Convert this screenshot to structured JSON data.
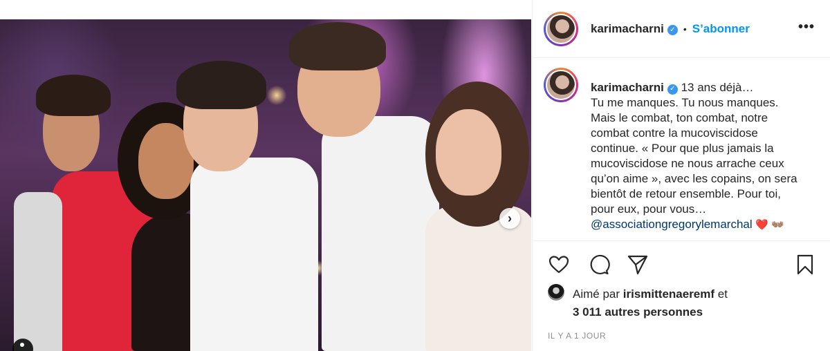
{
  "header": {
    "username": "karimacharni",
    "separator": "•",
    "follow_label": "S’abonner",
    "more_label": "•••"
  },
  "caption": {
    "username": "karimacharni",
    "lines": [
      "13 ans déjà…",
      "Tu me manques. Tu nous manques.",
      "Mais le combat, ton combat, notre",
      "combat contre la mucoviscidose",
      "continue. « Pour que plus jamais la",
      "mucoviscidose ne nous arrache ceux",
      "qu’on aime », avec les copains, on sera",
      "bientôt de retour ensemble. Pour toi,",
      "pour eux, pour vous…"
    ],
    "mention": "@associationgregorylemarchal",
    "emoji": "❤️ 👐🏽"
  },
  "likes": {
    "prefix": "Aimé par",
    "user": "irismittenaeremf",
    "conjunction": "et",
    "others": "3 011 autres personnes"
  },
  "timestamp": "IL Y A 1 JOUR",
  "media": {
    "next_icon": "chevron-right-icon",
    "next_symbol": "›"
  },
  "icons": [
    "heart-icon",
    "comment-icon",
    "share-icon",
    "bookmark-icon"
  ],
  "colors": {
    "accent": "#0095f6",
    "verified": "#3897f0",
    "text": "#262626",
    "muted": "#8e8e8e",
    "mention": "#00376b"
  }
}
